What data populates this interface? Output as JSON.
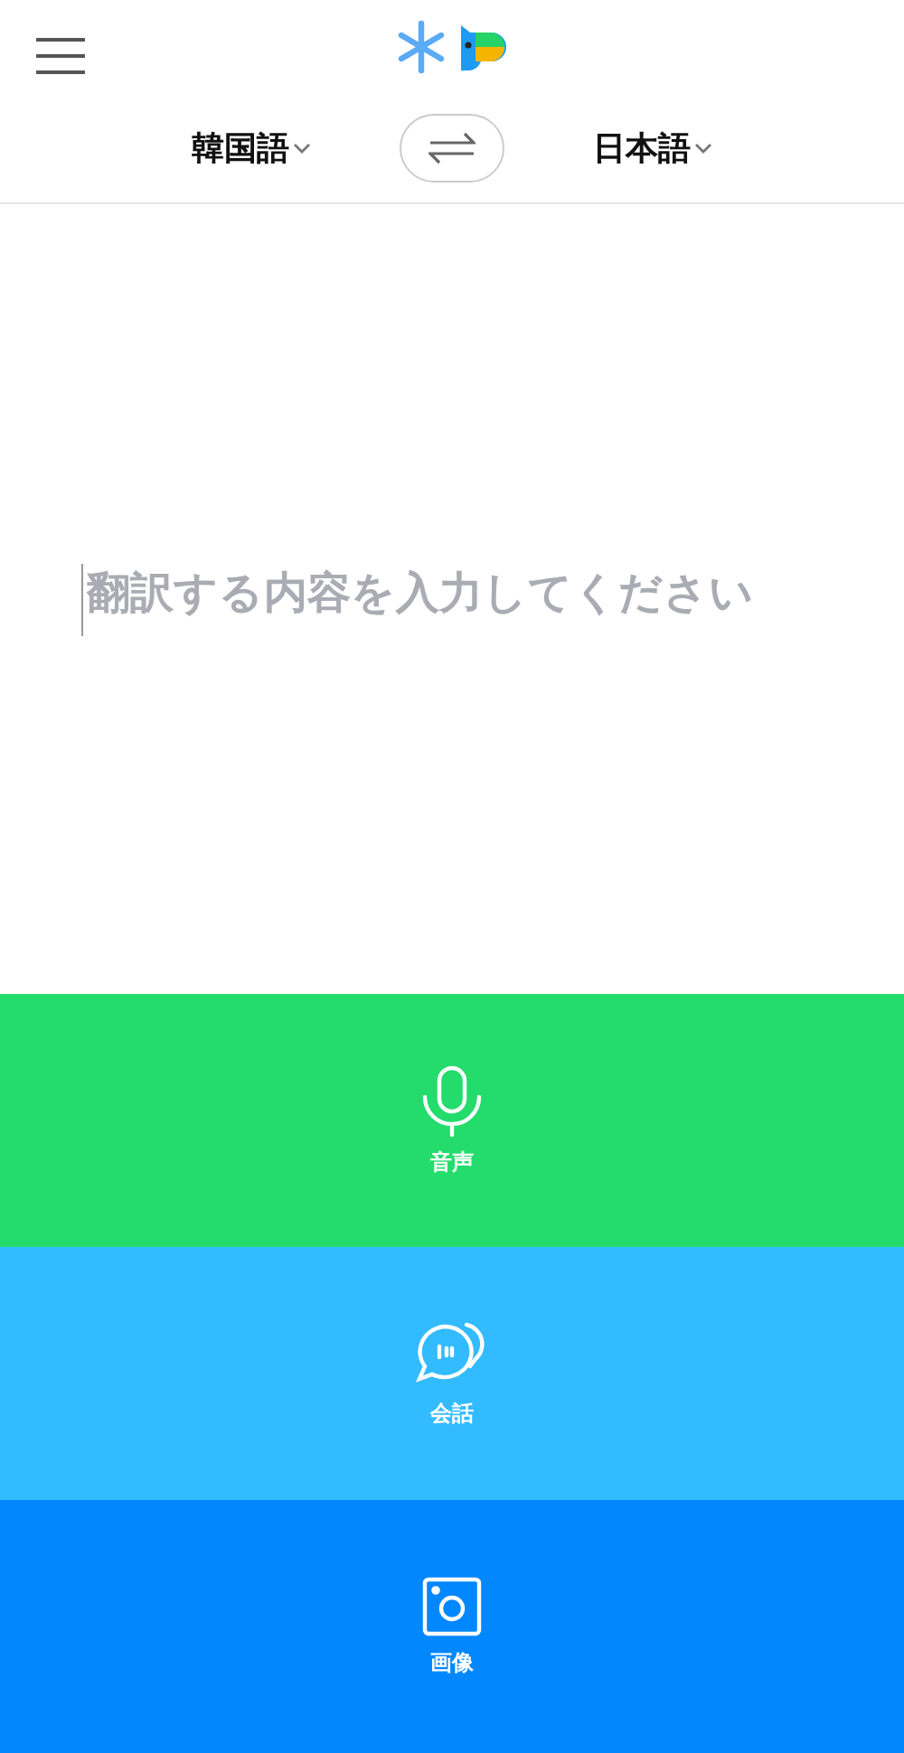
{
  "header": {
    "source_language": "韓国語",
    "target_language": "日本語"
  },
  "input": {
    "placeholder": "翻訳する内容を入力してください"
  },
  "modes": [
    {
      "kind": "voice",
      "label": "音声",
      "color": "#23dc6c"
    },
    {
      "kind": "conversation",
      "label": "会話",
      "color": "#33bbff"
    },
    {
      "kind": "image",
      "label": "画像",
      "color": "#0387fe"
    }
  ]
}
